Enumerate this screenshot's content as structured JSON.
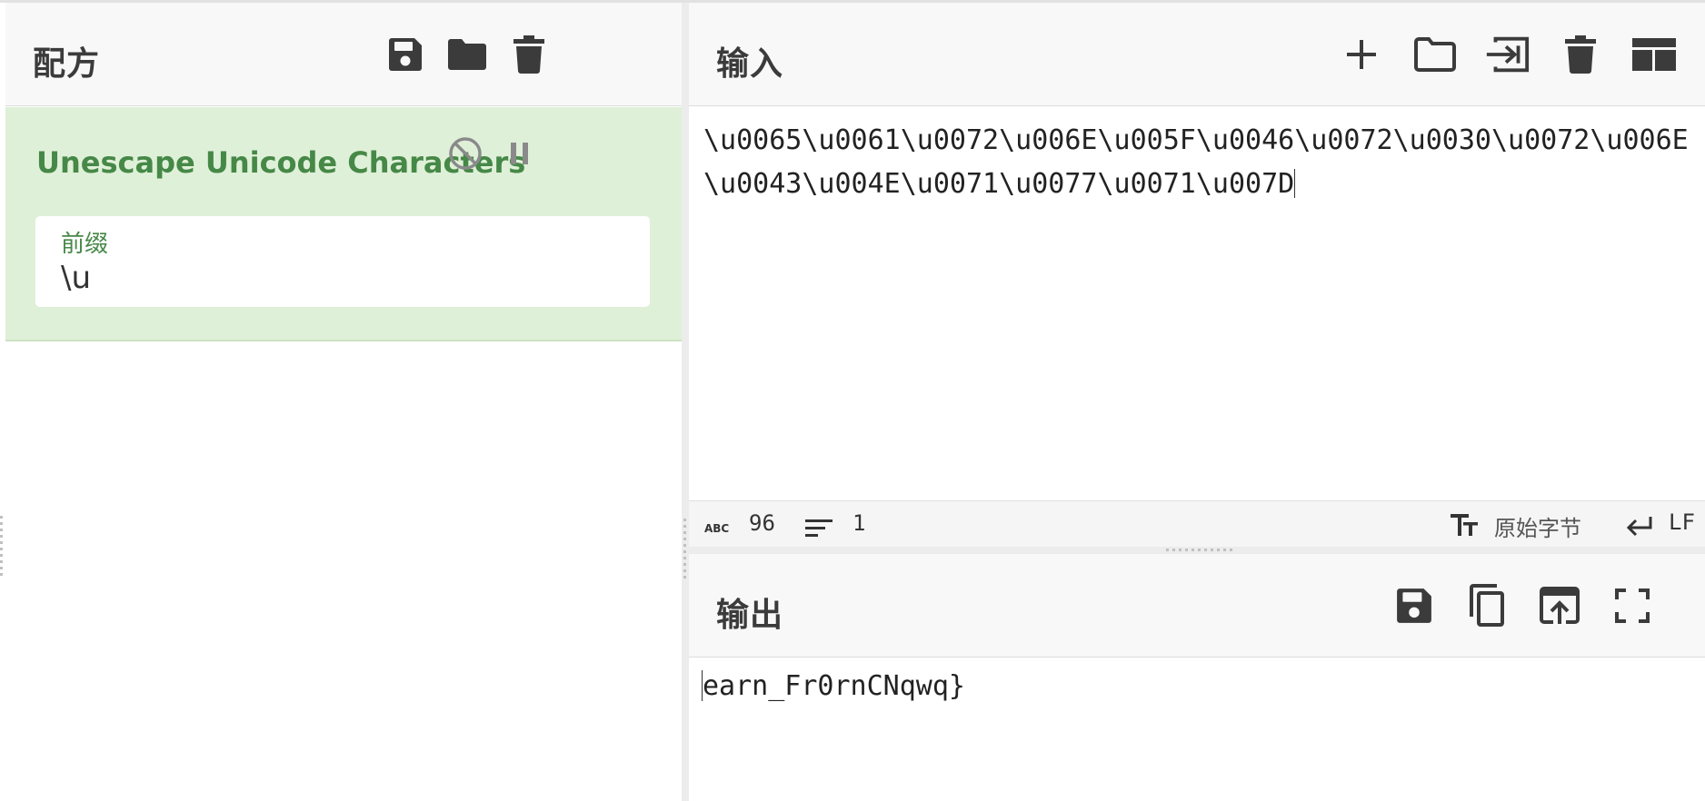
{
  "recipe": {
    "title": "配方",
    "toolbar": {
      "save_icon": "save-icon",
      "load_icon": "folder-icon",
      "clear_icon": "trash-icon"
    },
    "operations": [
      {
        "name": "Unescape Unicode Characters",
        "disable_icon": "disable-icon",
        "pause_icon": "pause-icon",
        "field_label": "前缀",
        "field_value": "\\u"
      }
    ]
  },
  "input": {
    "title": "输入",
    "toolbar_icons": [
      "plus-icon",
      "folder-icon",
      "import-icon",
      "trash-icon",
      "layout-icon"
    ],
    "text": "\\u0065\\u0061\\u0072\\u006E\\u005F\\u0046\\u0072\\u0030\\u0072\\u006E\\u0043\\u004E\\u0071\\u0077\\u0071\\u007D",
    "status": {
      "chars_label": "ABC",
      "chars": "96",
      "lines": "1",
      "encoding": "原始字节",
      "eol": "LF"
    }
  },
  "output": {
    "title": "输出",
    "toolbar_icons": [
      "save-icon",
      "copy-icon",
      "replace-input-icon",
      "maximize-icon"
    ],
    "text": "earn_Fr0rnCNqwq}"
  },
  "colors": {
    "accent_green": "#468847",
    "op_background": "#dff0d8",
    "header_background": "#f8f8f8",
    "icon_dark": "#3b3b3b"
  }
}
